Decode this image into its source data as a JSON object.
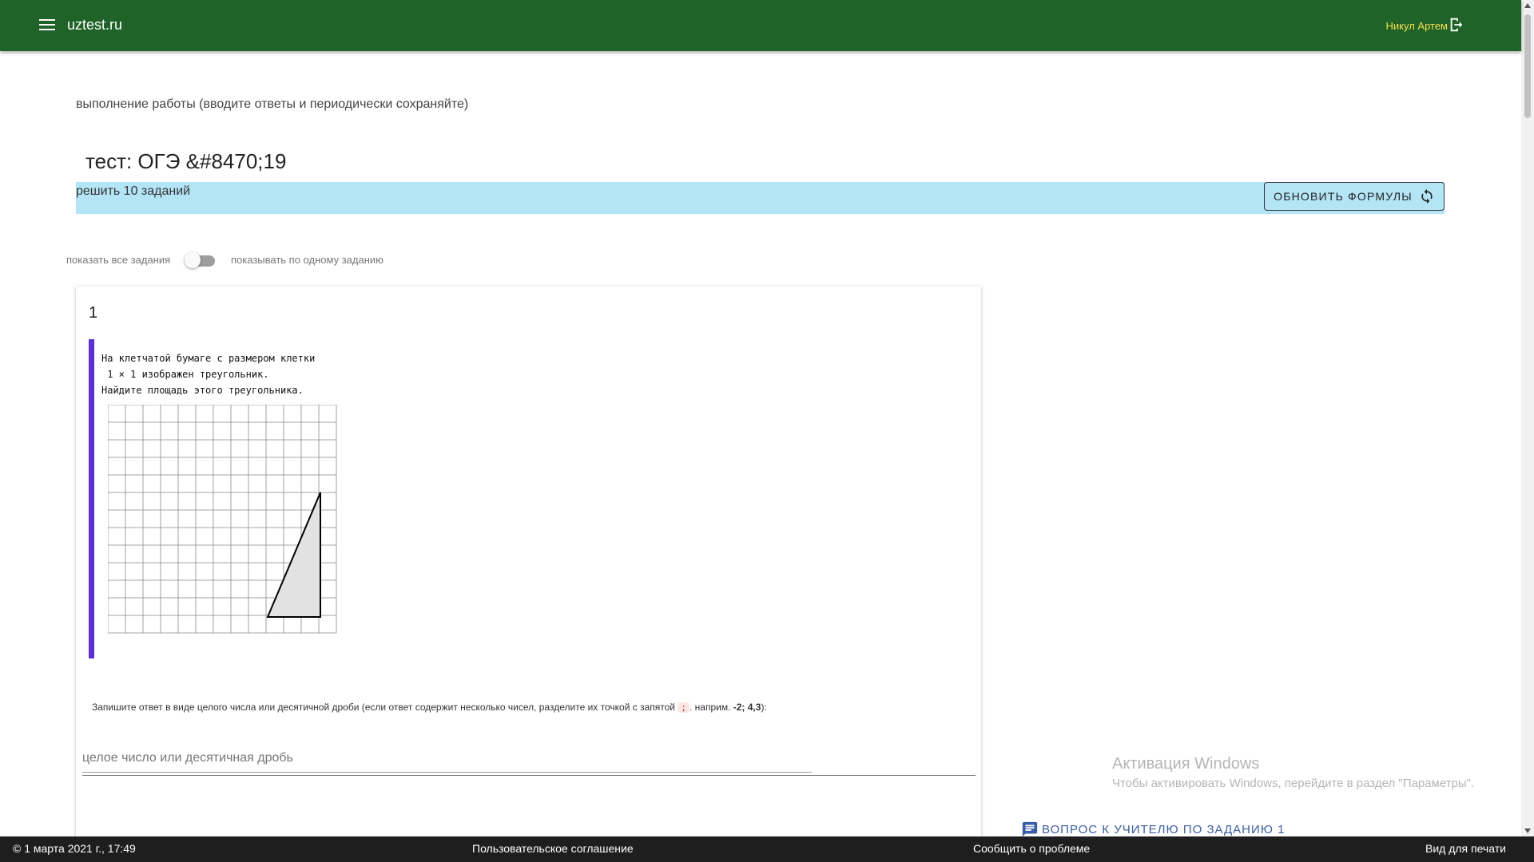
{
  "header": {
    "site_title": "uztest.ru",
    "user_name": "Никул Артем",
    "bg_color": "#1f6328",
    "user_color": "#f5e04a"
  },
  "page": {
    "subtitle": "выполнение работы (вводите ответы и периодически сохраняйте)",
    "test_title": "тест: ОГЭ &#8470;19",
    "task_banner": "решить 10 заданий",
    "refresh_button": "ОБНОВИТЬ ФОРМУЛЫ",
    "banner_color": "#b3e5f7"
  },
  "toggle": {
    "left_label": "показать все задания",
    "right_label": "показывать по одному заданию",
    "state": "off"
  },
  "task": {
    "number": "1",
    "problem_lines": [
      "На клетчатой бумаге с размером клетки",
      " 1 × 1 изображен треугольник.",
      "Найдите площадь этого треугольника."
    ],
    "answer_hint_prefix": "Запишите ответ в виде целого числа или десятичной дроби (если ответ содержит несколько чисел, разделите их точкой с запятой",
    "answer_hint_code": ";",
    "answer_hint_mid": ". наприм. ",
    "answer_hint_example": "-2; 4,3",
    "answer_hint_suffix": "):",
    "answer_placeholder": "целое число или десятичная дробь",
    "answer_value": "",
    "accent_color": "#5b2ddb",
    "ask_teacher": "ВОПРОС К УЧИТЕЛЮ ПО ЗАДАНИЮ 1"
  },
  "watermark": {
    "title": "Активация Windows",
    "subtitle": "Чтобы активировать Windows, перейдите в раздел \"Параметры\"."
  },
  "footer": {
    "date": "© 1 марта 2021 г., 17:49",
    "agreement": "Пользовательское соглашение",
    "report": "Сообщить о проблеме",
    "print_view": "Вид для печати"
  }
}
